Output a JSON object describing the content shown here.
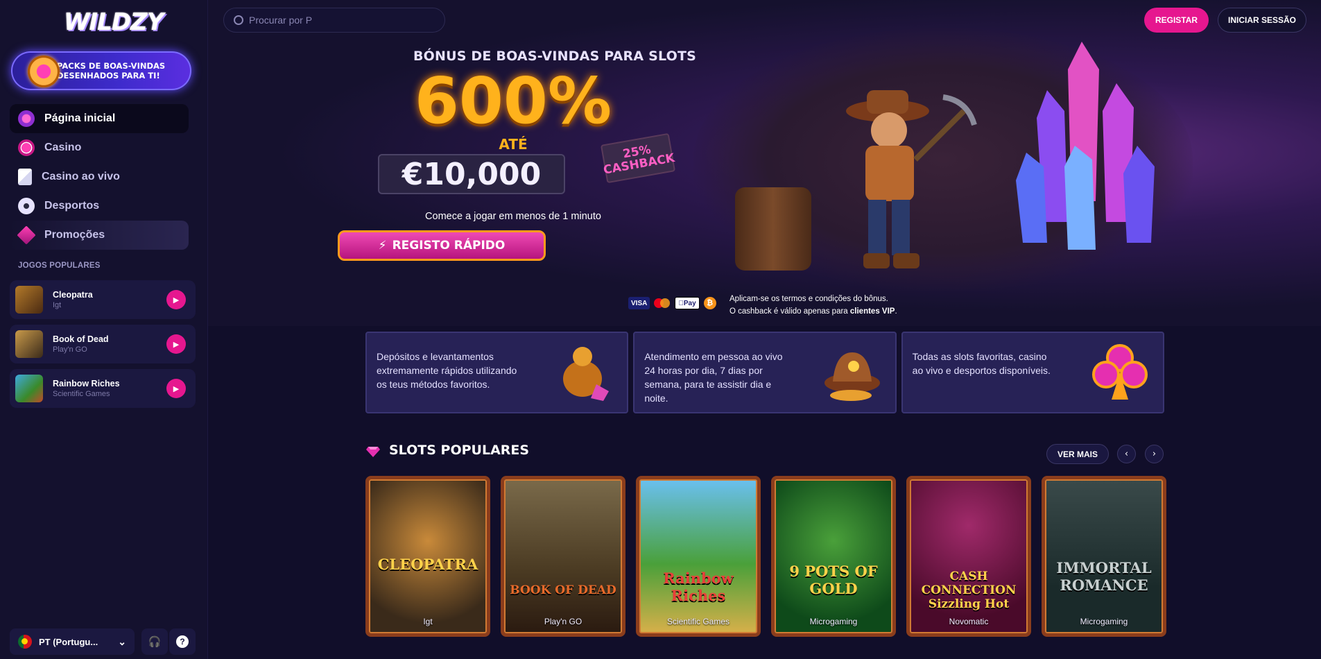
{
  "brand": {
    "logo_text": "WILDZY",
    "accent": "#e6178f"
  },
  "sidebar": {
    "promo_banner": "PACKS DE BOAS-VINDAS DESENHADOS PARA TI!",
    "nav": [
      {
        "label": "Página inicial",
        "icon": "home-icon",
        "active": true
      },
      {
        "label": "Casino",
        "icon": "casino-chip-icon"
      },
      {
        "label": "Casino ao vivo",
        "icon": "playing-card-icon"
      },
      {
        "label": "Desportos",
        "icon": "soccer-ball-icon"
      },
      {
        "label": "Promoções",
        "icon": "diamond-icon"
      }
    ],
    "popular_title": "JOGOS POPULARES",
    "popular_games": [
      {
        "name": "Cleopatra",
        "provider": "Igt"
      },
      {
        "name": "Book of Dead",
        "provider": "Play'n GO"
      },
      {
        "name": "Rainbow Riches",
        "provider": "Scientific Games"
      }
    ],
    "language": "PT (Portugu..."
  },
  "header": {
    "search_placeholder": "Procurar por P",
    "register_label": "REGISTAR",
    "login_label": "INICIAR SESSÃO"
  },
  "hero": {
    "kicker": "BÓNUS DE BOAS-VINDAS PARA SLOTS",
    "percent": "600%",
    "upto": "ATÉ",
    "amount": "€10,000",
    "cashback_badge": "25% CASHBACK",
    "subtitle": "Comece a jogar em menos de 1 minuto",
    "cta": "REGISTO RÁPIDO"
  },
  "payments": [
    "VISA",
    "Mastercard",
    "Apple Pay",
    "Bitcoin"
  ],
  "terms": {
    "line1": "Aplicam-se os termos e condições do bônus.",
    "line2_prefix": "O cashback é válido apenas para ",
    "line2_bold": "clientes VIP",
    "line2_suffix": "."
  },
  "features": [
    "Depósitos e levantamentos extremamente rápidos utilizando os teus métodos favoritos.",
    "Atendimento em pessoa ao vivo 24 horas por dia, 7 dias por semana, para te assistir dia e noite.",
    "Todas as slots favoritas, casino ao vivo e desportos disponíveis."
  ],
  "popular_slots": {
    "title": "SLOTS POPULARES",
    "see_more": "VER MAIS",
    "games": [
      {
        "title": "CLEOPATRA",
        "provider": "Igt",
        "bg": "#3a2a1a"
      },
      {
        "title": "BOOK OF DEAD",
        "provider": "Play'n GO",
        "bg": "#5a4a32"
      },
      {
        "title": "Rainbow Riches",
        "provider": "Scientific Games",
        "bg": "#4a8a3a"
      },
      {
        "title": "9 POTS OF GOLD",
        "provider": "Microgaming",
        "bg": "#1f6a2a"
      },
      {
        "title": "CASH CONNECTION Sizzling Hot",
        "provider": "Novomatic",
        "bg": "#7a1a4a"
      },
      {
        "title": "IMMORTAL ROMANCE",
        "provider": "Microgaming",
        "bg": "#2a3a3a"
      }
    ]
  }
}
